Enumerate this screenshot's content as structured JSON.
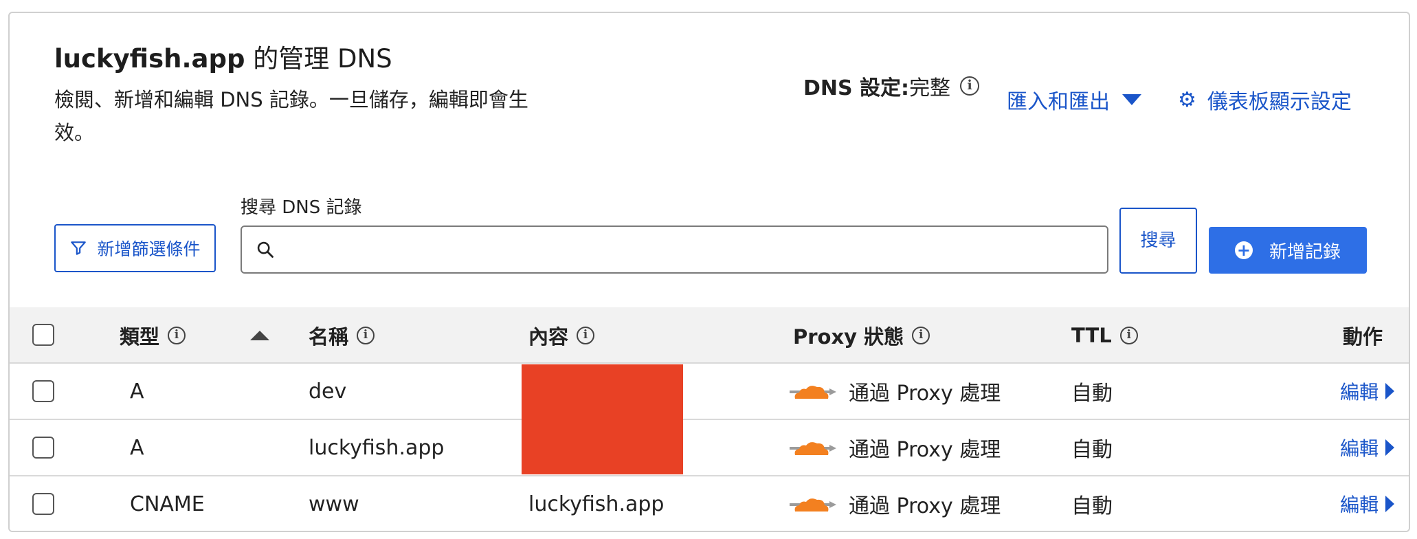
{
  "header": {
    "title_domain": "luckyfish.app",
    "title_rest": " 的管理 DNS",
    "description": "檢閱、新增和編輯 DNS 記錄。一旦儲存，編輯即會生效。",
    "dns_setting_label": "DNS 設定:",
    "dns_setting_value": "完整",
    "import_export": "匯入和匯出",
    "dashboard_settings": "儀表板顯示設定"
  },
  "toolbar": {
    "filter_button": "新增篩選條件",
    "search_label": "搜尋 DNS 記錄",
    "search_value": "",
    "search_button": "搜尋",
    "add_record_button": "新增記錄"
  },
  "table": {
    "columns": {
      "type": "類型",
      "name": "名稱",
      "content": "內容",
      "proxy_status": "Proxy 狀態",
      "ttl": "TTL",
      "actions": "動作"
    },
    "rows": [
      {
        "type": "A",
        "name": "dev",
        "content": "",
        "proxy": "通過 Proxy 處理",
        "ttl": "自動",
        "action": "編輯"
      },
      {
        "type": "A",
        "name": "luckyfish.app",
        "content": "",
        "proxy": "通過 Proxy 處理",
        "ttl": "自動",
        "action": "編輯"
      },
      {
        "type": "CNAME",
        "name": "www",
        "content": "luckyfish.app",
        "proxy": "通過 Proxy 處理",
        "ttl": "自動",
        "action": "編輯"
      }
    ]
  },
  "colors": {
    "accent": "#1a55c9",
    "primary_button": "#2e6fe6",
    "cloud_orange": "#f38020",
    "redaction": "#e84125"
  },
  "icons": [
    "info-icon",
    "caret-down-icon",
    "gear-icon",
    "filter-icon",
    "search-icon",
    "plus-circle-icon",
    "sort-up-icon",
    "cloud-proxy-icon",
    "caret-right-icon"
  ]
}
